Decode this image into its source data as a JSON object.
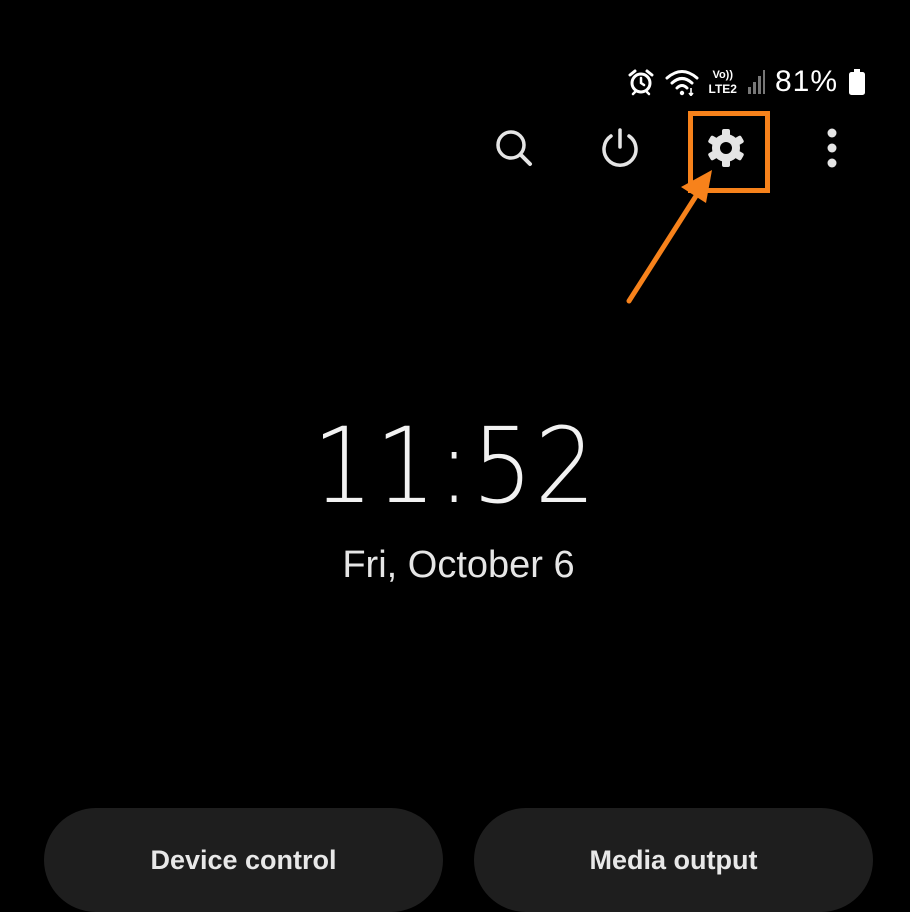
{
  "status_bar": {
    "icons": [
      "alarm-icon",
      "wifi-icon",
      "volte-lte2-icon",
      "signal-icon",
      "battery-icon"
    ],
    "volte_top": "Vo))",
    "volte_bottom": "LTE2",
    "battery_percent": "81%"
  },
  "toolbar": {
    "buttons": [
      "search-icon",
      "power-icon",
      "settings-gear-icon",
      "more-options-icon"
    ],
    "highlight_color": "#f7821b"
  },
  "lockscreen": {
    "time": "11:52",
    "date": "Fri, October 6"
  },
  "bottom_buttons": {
    "device_control": "Device control",
    "media_output": "Media output"
  },
  "colors": {
    "background": "#000000",
    "pill_background": "#1e1e1e",
    "accent": "#f7821b"
  }
}
